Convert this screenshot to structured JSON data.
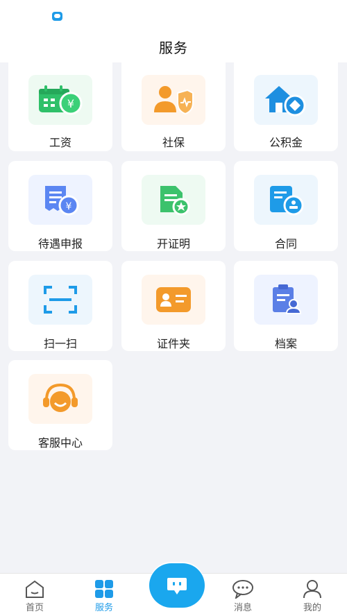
{
  "header": {
    "title": "服务"
  },
  "services": [
    {
      "label": "工资",
      "icon": "salary-calendar-icon",
      "tile_color": "#eefaf2",
      "accent": "#2fc069"
    },
    {
      "label": "社保",
      "icon": "social-insurance-icon",
      "tile_color": "#fff5ec",
      "accent": "#f39a2b"
    },
    {
      "label": "公积金",
      "icon": "housing-fund-icon",
      "tile_color": "#edf6fd",
      "accent": "#1e8fe0"
    },
    {
      "label": "待遇申报",
      "icon": "benefit-declaration-icon",
      "tile_color": "#eef3ff",
      "accent": "#5b86f2"
    },
    {
      "label": "开证明",
      "icon": "certificate-icon",
      "tile_color": "#eefaf2",
      "accent": "#3cc26c"
    },
    {
      "label": "合同",
      "icon": "contract-icon",
      "tile_color": "#edf6fd",
      "accent": "#1e9be8"
    },
    {
      "label": "扫一扫",
      "icon": "scan-icon",
      "tile_color": "#edf6fd",
      "accent": "#1e9be8"
    },
    {
      "label": "证件夹",
      "icon": "id-card-folder-icon",
      "tile_color": "#fff5ec",
      "accent": "#f39a2b"
    },
    {
      "label": "档案",
      "icon": "archive-icon",
      "tile_color": "#eef3ff",
      "accent": "#5b7fe6"
    },
    {
      "label": "客服中心",
      "icon": "customer-service-icon",
      "tile_color": "#fff5ec",
      "accent": "#f39a2b"
    }
  ],
  "tabbar": {
    "items": [
      {
        "label": "首页",
        "icon": "home-icon"
      },
      {
        "label": "服务",
        "icon": "services-grid-icon",
        "active": true
      },
      {
        "label": "消息",
        "icon": "message-icon"
      },
      {
        "label": "我的",
        "icon": "profile-icon"
      }
    ],
    "center_icon": "assistant-bot-icon"
  },
  "colors": {
    "accent": "#1e9be8",
    "background": "#f2f3f7"
  }
}
